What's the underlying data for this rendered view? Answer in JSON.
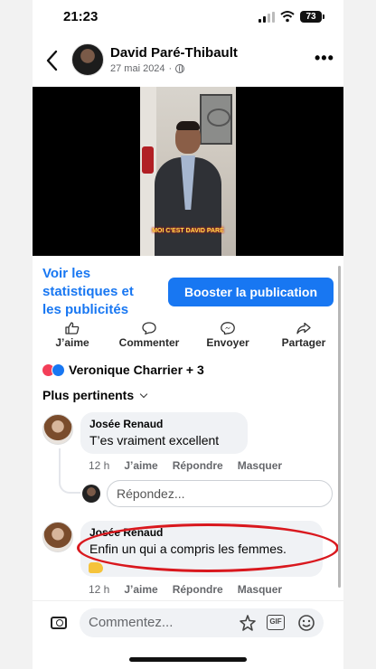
{
  "status_bar": {
    "time": "21:23",
    "battery": "73"
  },
  "post": {
    "author": "David Paré-Thibault",
    "date": "27 mai 2024",
    "video_caption": "MOI C'EST DAVID PARÉ"
  },
  "insights": {
    "stats_link": "Voir les statistiques et les publicités",
    "boost_button": "Booster la publication"
  },
  "actions": [
    {
      "label": "J’aime",
      "icon": "thumbs-up-icon"
    },
    {
      "label": "Commenter",
      "icon": "comment-icon"
    },
    {
      "label": "Envoyer",
      "icon": "messenger-icon"
    },
    {
      "label": "Partager",
      "icon": "share-icon"
    }
  ],
  "reactions": {
    "summary": "Veronique Charrier + 3",
    "types": [
      "love",
      "like"
    ]
  },
  "sort": {
    "label": "Plus pertinents"
  },
  "comments": [
    {
      "author": "Josée Renaud",
      "text": "T’es vraiment excellent",
      "time": "12 h",
      "like": "J’aime",
      "reply": "Répondre",
      "hide": "Masquer"
    },
    {
      "author": "Josée Renaud",
      "text": "Enfin un qui a compris les femmes.",
      "time": "12 h",
      "like": "J’aime",
      "reply": "Répondre",
      "hide": "Masquer"
    }
  ],
  "reply_box": {
    "placeholder": "Répondez..."
  },
  "composer": {
    "placeholder": "Commentez...",
    "gif_label": "GIF"
  },
  "colors": {
    "accent": "#1877f2",
    "highlight": "#d9181e",
    "bubble": "#f0f2f5",
    "love": "#f33e58"
  }
}
